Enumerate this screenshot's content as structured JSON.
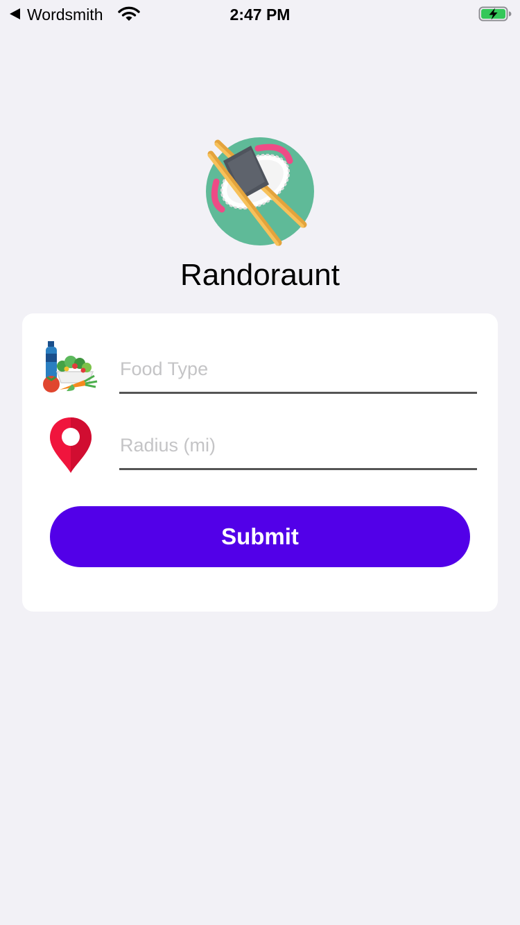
{
  "status_bar": {
    "back_app": "Wordsmith",
    "time": "2:47 PM",
    "icons": [
      "back-arrow-icon",
      "wifi-icon",
      "battery-charging-icon"
    ]
  },
  "header": {
    "logo": "sushi-chopsticks-logo",
    "title": "Randoraunt"
  },
  "form": {
    "food_type": {
      "icon": "groceries-icon",
      "placeholder": "Food Type",
      "value": ""
    },
    "radius": {
      "icon": "location-pin-icon",
      "placeholder": "Radius (mi)",
      "value": ""
    },
    "submit_label": "Submit"
  },
  "colors": {
    "background": "#f2f1f6",
    "card": "#ffffff",
    "accent": "#5200e8",
    "input_underline": "#555555",
    "placeholder": "#c4c4c6",
    "battery_green": "#34c759"
  }
}
